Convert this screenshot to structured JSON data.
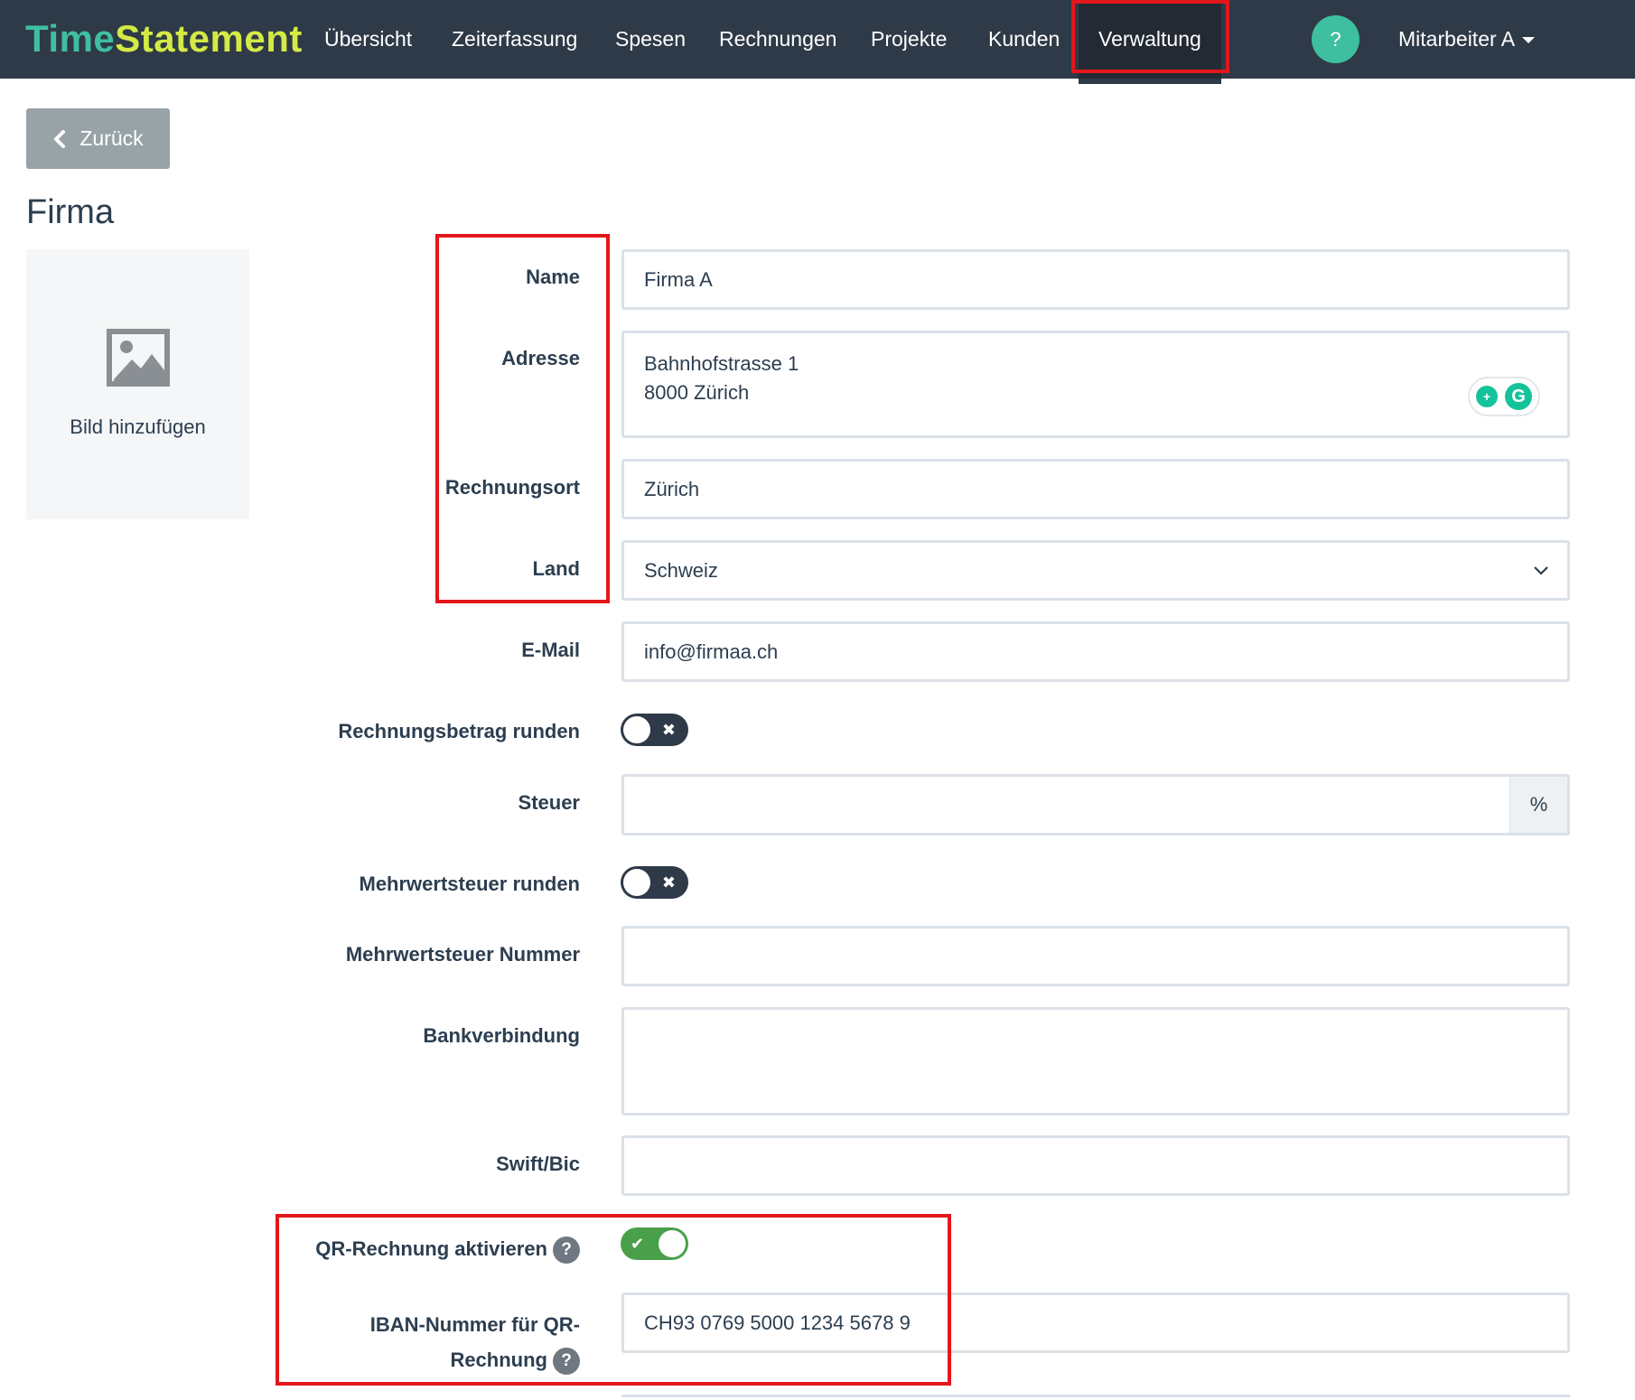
{
  "navbar": {
    "brand_part1": "Time",
    "brand_part2": "Statement",
    "items": [
      {
        "label": "Übersicht"
      },
      {
        "label": "Zeiterfassung"
      },
      {
        "label": "Spesen"
      },
      {
        "label": "Rechnungen"
      },
      {
        "label": "Projekte"
      },
      {
        "label": "Kunden"
      },
      {
        "label": "Verwaltung",
        "active": true
      }
    ],
    "help_label": "?",
    "user_label": "Mitarbeiter A"
  },
  "back_button": {
    "label": "Zurück",
    "icon": "chevron-left-icon"
  },
  "page": {
    "title": "Firma"
  },
  "image_upload": {
    "label": "Bild hinzufügen",
    "icon": "image-placeholder-icon"
  },
  "form": {
    "name": {
      "label": "Name",
      "value": "Firma A"
    },
    "adresse": {
      "label": "Adresse",
      "line1": "Bahnhofstrasse 1",
      "line2": "8000 Zürich"
    },
    "rechnungsort": {
      "label": "Rechnungsort",
      "value": "Zürich"
    },
    "land": {
      "label": "Land",
      "value": "Schweiz"
    },
    "email": {
      "label": "E-Mail",
      "value": "info@firmaa.ch"
    },
    "rechnungsbetrag_runden": {
      "label": "Rechnungsbetrag runden",
      "enabled": false,
      "mark": "✖"
    },
    "steuer": {
      "label": "Steuer",
      "value": "",
      "unit": "%"
    },
    "mwst_runden": {
      "label": "Mehrwertsteuer runden",
      "enabled": false,
      "mark": "✖"
    },
    "mwst_nummer": {
      "label": "Mehrwertsteuer Nummer",
      "value": ""
    },
    "bankverbindung": {
      "label": "Bankverbindung",
      "value": ""
    },
    "swift": {
      "label": "Swift/Bic",
      "value": ""
    },
    "qr_rechnung": {
      "label": "QR-Rechnung aktivieren",
      "enabled": true,
      "mark": "✔",
      "help": "?"
    },
    "iban": {
      "label_line1": "IBAN-Nummer für QR-",
      "label_line2": "Rechnung",
      "value": "CH93 0769 5000 1234 5678 9",
      "help": "?"
    }
  },
  "colors": {
    "navbar_bg": "#2f3a48",
    "brand_time": "#3fbfa0",
    "brand_statement": "#d4ea45",
    "highlight": "#e3161c",
    "toggle_on": "#4aa04a"
  }
}
